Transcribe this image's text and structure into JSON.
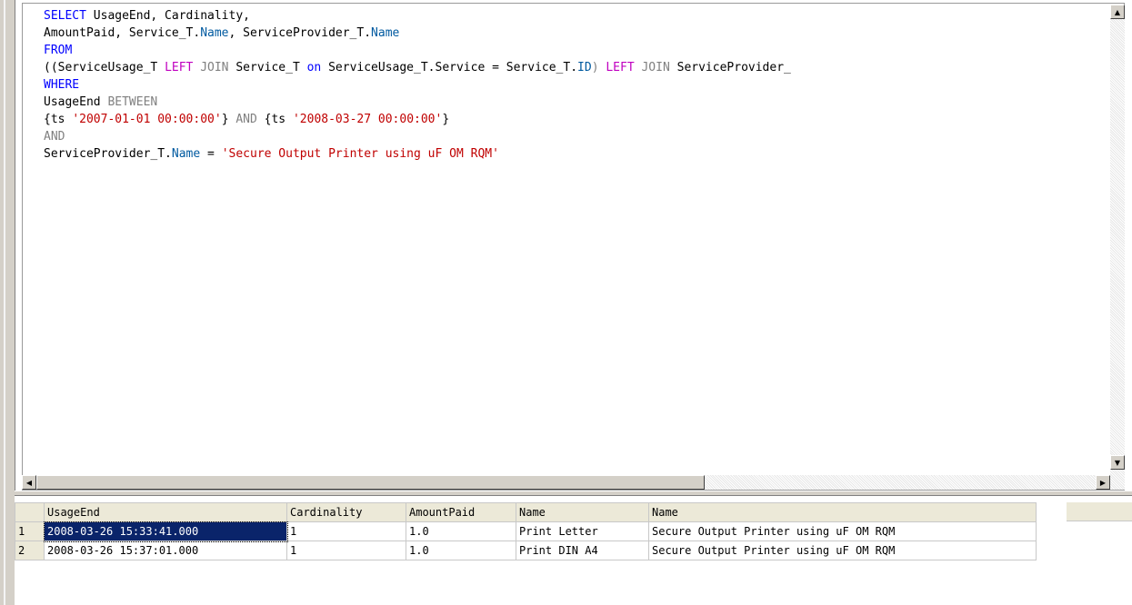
{
  "editor": {
    "lines": [
      [
        {
          "t": "SELECT",
          "c": "kw"
        },
        {
          "t": " UsageEnd, Cardinality,",
          "c": ""
        }
      ],
      [
        {
          "t": "AmountPaid, Service_T.",
          "c": ""
        },
        {
          "t": "Name",
          "c": "fld"
        },
        {
          "t": ", ServiceProvider_T.",
          "c": ""
        },
        {
          "t": "Name",
          "c": "fld"
        }
      ],
      [
        {
          "t": "FROM",
          "c": "kw"
        }
      ],
      [
        {
          "t": "((ServiceUsage_T ",
          "c": ""
        },
        {
          "t": "LEFT",
          "c": "kw2"
        },
        {
          "t": " JOIN",
          "c": "op"
        },
        {
          "t": " Service_T ",
          "c": ""
        },
        {
          "t": "on",
          "c": "kw"
        },
        {
          "t": " ServiceUsage_T.Service = Service_T.",
          "c": ""
        },
        {
          "t": "ID",
          "c": "fld"
        },
        {
          "t": ") ",
          "c": "op"
        },
        {
          "t": "LEFT",
          "c": "kw2"
        },
        {
          "t": " JOIN",
          "c": "op"
        },
        {
          "t": " ServiceProvider_",
          "c": ""
        }
      ],
      [
        {
          "t": "WHERE",
          "c": "kw"
        }
      ],
      [
        {
          "t": "UsageEnd ",
          "c": ""
        },
        {
          "t": "BETWEEN",
          "c": "op"
        }
      ],
      [
        {
          "t": "{ts ",
          "c": ""
        },
        {
          "t": "'2007-01-01 00:00:00'",
          "c": "str"
        },
        {
          "t": "} ",
          "c": ""
        },
        {
          "t": "AND",
          "c": "op"
        },
        {
          "t": " {ts ",
          "c": ""
        },
        {
          "t": "'2008-03-27 00:00:00'",
          "c": "str"
        },
        {
          "t": "}",
          "c": ""
        }
      ],
      [
        {
          "t": "AND",
          "c": "op"
        }
      ],
      [
        {
          "t": "ServiceProvider_T.",
          "c": ""
        },
        {
          "t": "Name",
          "c": "fld"
        },
        {
          "t": " = ",
          "c": ""
        },
        {
          "t": "'Secure Output Printer using uF OM RQM'",
          "c": "str"
        }
      ]
    ]
  },
  "results": {
    "columns": [
      "UsageEnd",
      "Cardinality",
      "AmountPaid",
      "Name",
      "Name"
    ],
    "column_widths": [
      267,
      131,
      121,
      146,
      426
    ],
    "rows": [
      {
        "num": "1",
        "cells": [
          "2008-03-26 15:33:41.000",
          "1",
          "1.0",
          "Print Letter",
          "Secure Output Printer using uF OM RQM"
        ]
      },
      {
        "num": "2",
        "cells": [
          "2008-03-26 15:37:01.000",
          "1",
          "1.0",
          "Print DIN A4",
          "Secure Output Printer using uF OM RQM"
        ]
      }
    ],
    "selected": {
      "row": 0,
      "col": 0
    }
  },
  "icons": {
    "scroll_up": "▲",
    "scroll_down": "▼",
    "scroll_left": "◀",
    "scroll_right": "▶"
  },
  "colors": {
    "keyword": "#0000ff",
    "join_keyword": "#c000c0",
    "operator": "#808080",
    "string": "#c00000",
    "field": "#005aa0",
    "selection": "#0a246a"
  }
}
